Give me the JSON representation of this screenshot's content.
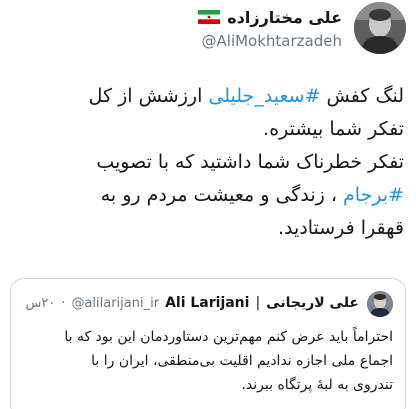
{
  "author": {
    "display_name": "علی مختارزاده",
    "handle": "@AliMokhtarzadeh",
    "avatar_icon": "user-avatar-photo",
    "flag_icon": "iran-flag-icon"
  },
  "tweet": {
    "lines": [
      {
        "pre": "لنگ کفش ",
        "hashtag": "#سعید_جلیلی",
        "post": " ارزشش از کل"
      },
      {
        "pre": "تفکر شما بیشتره.",
        "hashtag": "",
        "post": ""
      },
      {
        "pre": "تفکر خطرناک شما داشتید که با تصویب",
        "hashtag": "",
        "post": ""
      },
      {
        "pre": "",
        "hashtag": "#برجام",
        "post": " ، زندگی و معیشت مردم رو به"
      },
      {
        "pre": "قهقرا فرستادید.",
        "hashtag": "",
        "post": ""
      }
    ]
  },
  "quoted": {
    "display_name_fa": "علی لاریجانی",
    "separator": "|",
    "display_name_en": "Ali Larijani",
    "handle": "@alilarijani_ir",
    "dot": "·",
    "time": "۲۰س",
    "avatar_icon": "user-avatar-photo",
    "lines": [
      "احتراماً باید عرض کنم مهم‌ترین دستاوردمان این بود که با",
      "اجماع ملی اجازه ندادیم اقلیت بی‌منطقی، ایران را با",
      "تندروی به لبهٔ پرتگاه ببرند."
    ]
  },
  "colors": {
    "hashtag": "#1b95e0",
    "secondary_text": "#657786",
    "border": "#ccd6dd"
  }
}
